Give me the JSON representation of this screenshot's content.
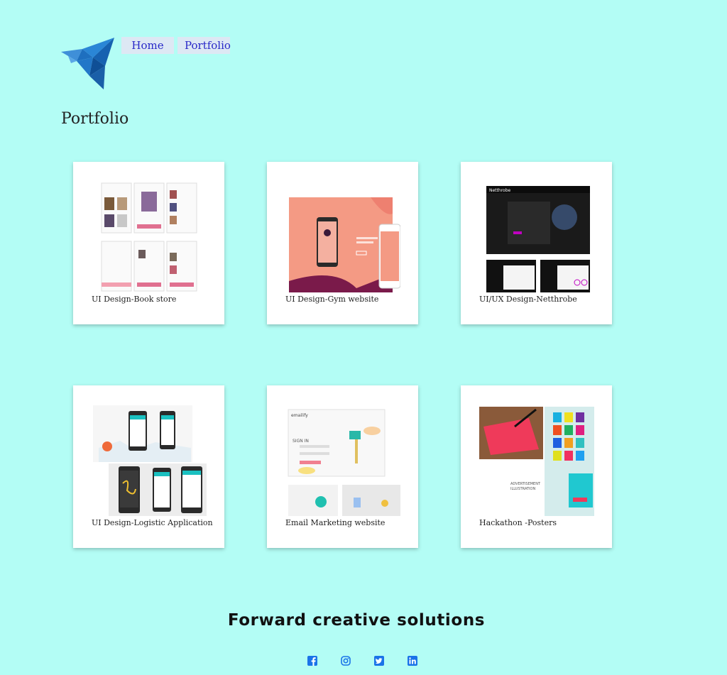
{
  "nav": {
    "home_label": "Home",
    "portfolio_label": "Portfolio"
  },
  "page": {
    "title": "Portfolio",
    "tagline": "Forward creative solutions"
  },
  "cards": [
    {
      "caption": "UI Design-Book store",
      "thumb": "book-store-mockup"
    },
    {
      "caption": "UI Design-Gym website",
      "thumb": "gym-website-mockup"
    },
    {
      "caption": "UI/UX Design-Netthrobe",
      "thumb": "netthrobe-mockup"
    },
    {
      "caption": "UI Design-Logistic Application",
      "thumb": "logistic-app-mockup"
    },
    {
      "caption": "Email Marketing website",
      "thumb": "email-marketing-mockup"
    },
    {
      "caption": "Hackathon -Posters",
      "thumb": "hackathon-posters"
    }
  ],
  "socials": [
    {
      "icon": "facebook-icon"
    },
    {
      "icon": "instagram-icon"
    },
    {
      "icon": "twitter-icon"
    },
    {
      "icon": "linkedin-icon"
    }
  ],
  "colors": {
    "background": "#b3fdf5",
    "nav_bg": "#dde8f4",
    "nav_text": "#2929c8",
    "social_icon": "#1a73e8"
  }
}
